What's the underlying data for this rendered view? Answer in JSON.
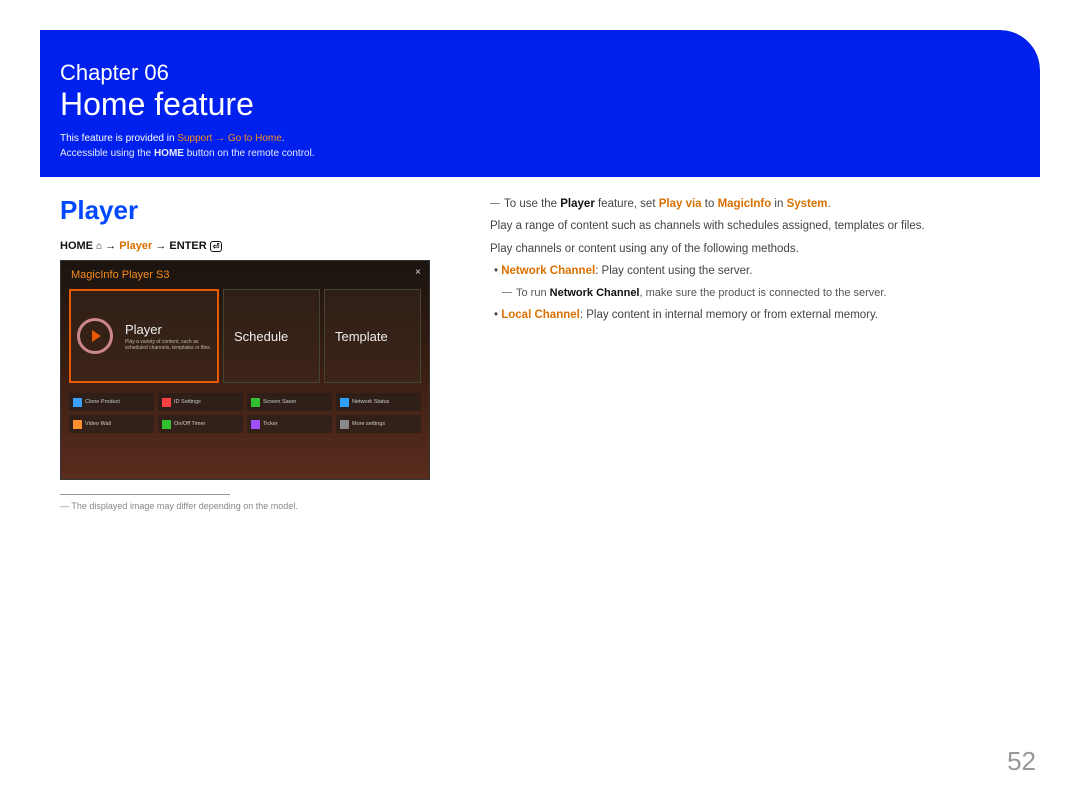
{
  "header": {
    "chapter_label": "Chapter  06",
    "chapter_title": "Home feature",
    "support_prefix": "This feature is provided in ",
    "support_link1": "Support",
    "support_arrow": " → ",
    "support_link2": "Go to Home",
    "support_suffix": ".",
    "accessible_prefix": "Accessible using the ",
    "accessible_bold": "HOME",
    "accessible_suffix": " button on the remote control."
  },
  "left": {
    "section_title": "Player",
    "bc_home": "HOME",
    "bc_home_icon": "⌂",
    "bc_arrow": " → ",
    "bc_player": "Player",
    "bc_enter": "ENTER",
    "bc_enter_icon": "⏎",
    "screenshot": {
      "app_title": "MagicInfo Player S3",
      "close": "×",
      "tile_player": "Player",
      "tile_player_sub": "Play a variety of content, such as scheduled channels, templates or files.",
      "tile_schedule": "Schedule",
      "tile_template": "Template",
      "grid": [
        {
          "icon": "#3aa0ff",
          "label": "Clone Product"
        },
        {
          "icon": "#ff4040",
          "label": "ID Settings"
        },
        {
          "icon": "#30c030",
          "label": "Screen Saver"
        },
        {
          "icon": "#30a0ff",
          "label": "Network Status"
        },
        {
          "icon": "#ff9030",
          "label": "Video Wall"
        },
        {
          "icon": "#30c030",
          "label": "On/Off Timer"
        },
        {
          "icon": "#a050ff",
          "label": "Ticker"
        },
        {
          "icon": "#888",
          "label": "More settings"
        }
      ]
    },
    "disclaimer": "The displayed image may differ depending on the model."
  },
  "right": {
    "note1_pre": "To use the ",
    "note1_b1": "Player",
    "note1_mid1": " feature, set ",
    "note1_o1": "Play via",
    "note1_mid2": " to ",
    "note1_o2": "MagicInfo",
    "note1_mid3": " in ",
    "note1_o3": "System",
    "note1_suf": ".",
    "p1": "Play a range of content such as channels with schedules assigned, templates or files.",
    "p2": "Play channels or content using any of the following methods.",
    "b1_o": "Network Channel",
    "b1_txt": ": Play content using the server.",
    "b1_sub_pre": "To run ",
    "b1_sub_b": "Network Channel",
    "b1_sub_suf": ", make sure the product is connected to the server.",
    "b2_o": "Local Channel",
    "b2_txt": ": Play content in internal memory or from external memory."
  },
  "page_number": "52"
}
